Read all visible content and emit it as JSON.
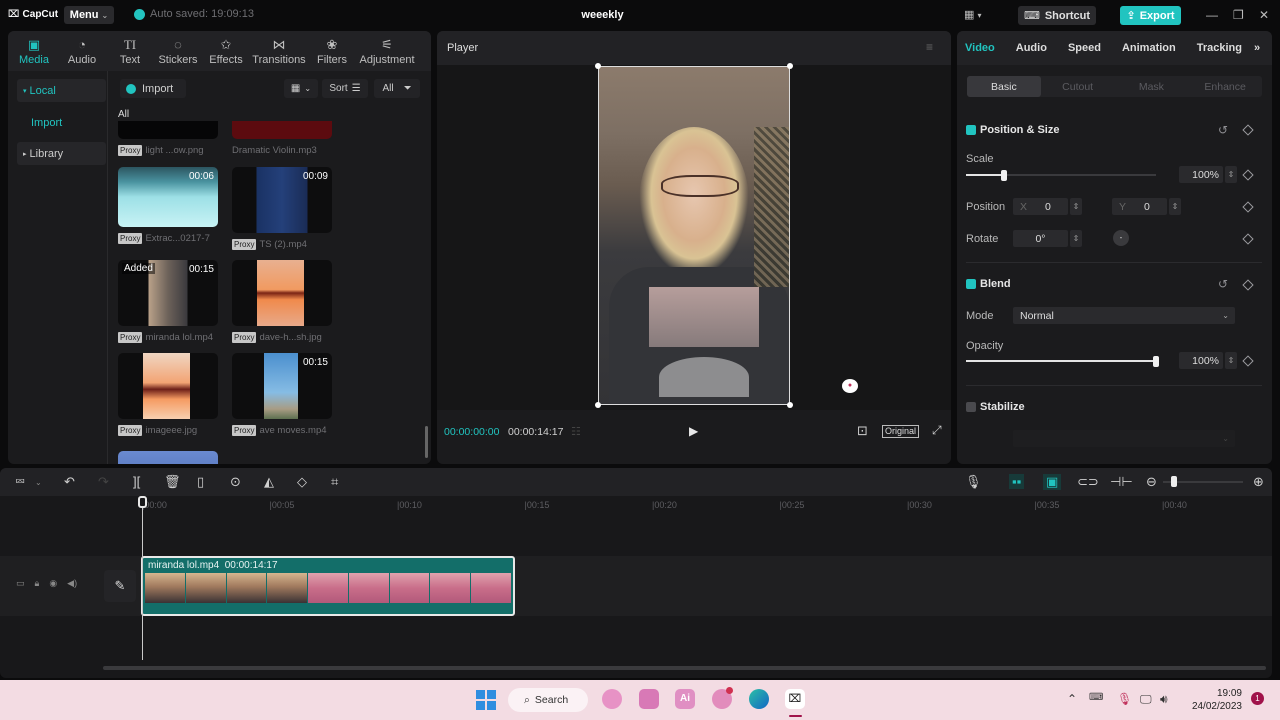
{
  "app": {
    "logo": "CapCut",
    "menu_label": "Menu",
    "autosave": "Auto saved: 19:09:13",
    "project_title": "weeekly",
    "shortcut_label": "Shortcut",
    "export_label": "Export",
    "accent": "#21c4c0"
  },
  "media_tools": [
    {
      "label": "Media",
      "icon": "media-icon",
      "glyph": "▣"
    },
    {
      "label": "Audio",
      "icon": "audio-icon",
      "glyph": "◔"
    },
    {
      "label": "Text",
      "icon": "text-icon",
      "glyph": "TI"
    },
    {
      "label": "Stickers",
      "icon": "stickers-icon",
      "glyph": "◌"
    },
    {
      "label": "Effects",
      "icon": "effects-icon",
      "glyph": "✩"
    },
    {
      "label": "Transitions",
      "icon": "transitions-icon",
      "glyph": "⋈"
    },
    {
      "label": "Filters",
      "icon": "filters-icon",
      "glyph": "❀"
    },
    {
      "label": "Adjustment",
      "icon": "adjustment-icon",
      "glyph": "⚟"
    }
  ],
  "sidebar": {
    "local": "Local",
    "import": "Import",
    "library": "Library"
  },
  "media": {
    "import_label": "Import",
    "sort_label": "Sort",
    "filter_label": "All",
    "section_label": "All",
    "proxy_badge": "Proxy",
    "added_badge": "Added",
    "items": [
      {
        "name": "light ...ow.png",
        "duration": "",
        "proxy": true
      },
      {
        "name": "Dramatic Violin.mp3",
        "duration": "",
        "proxy": false
      },
      {
        "name": "Extrac...0217-7",
        "duration": "00:06",
        "proxy": true
      },
      {
        "name": "TS (2).mp4",
        "duration": "00:09",
        "proxy": true
      },
      {
        "name": "miranda lol.mp4",
        "duration": "00:15",
        "proxy": true,
        "added": true
      },
      {
        "name": "dave-h...sh.jpg",
        "duration": "",
        "proxy": true
      },
      {
        "name": "imageee.jpg",
        "duration": "",
        "proxy": true
      },
      {
        "name": "ave moves.mp4",
        "duration": "00:15",
        "proxy": true
      }
    ]
  },
  "player": {
    "title": "Player",
    "current_time": "00:00:00:00",
    "total_time": "00:00:14:17",
    "ratio_label": "Original"
  },
  "props": {
    "tabs": [
      "Video",
      "Audio",
      "Speed",
      "Animation",
      "Tracking"
    ],
    "subtabs": [
      "Basic",
      "Cutout",
      "Mask",
      "Enhance"
    ],
    "position_size": {
      "title": "Position & Size",
      "scale_label": "Scale",
      "scale_value": "100%",
      "scale_fraction": 0.2,
      "position_label": "Position",
      "x_label": "X",
      "x_value": "0",
      "y_label": "Y",
      "y_value": "0",
      "rotate_label": "Rotate",
      "rotate_value": "0°"
    },
    "blend": {
      "title": "Blend",
      "mode_label": "Mode",
      "mode_value": "Normal",
      "opacity_label": "Opacity",
      "opacity_value": "100%",
      "opacity_fraction": 1.0
    },
    "stabilize": {
      "title": "Stabilize",
      "enabled": false
    }
  },
  "timeline": {
    "ticks": [
      "00:00",
      "00:05",
      "00:10",
      "00:15",
      "00:20",
      "00:25",
      "00:30",
      "00:35",
      "00:40"
    ],
    "clip": {
      "name": "miranda lol.mp4",
      "duration": "00:00:14:17"
    },
    "zoom_fraction": 0.1
  },
  "taskbar": {
    "search_label": "Search",
    "time": "19:09",
    "date": "24/02/2023",
    "notifications": "1"
  }
}
